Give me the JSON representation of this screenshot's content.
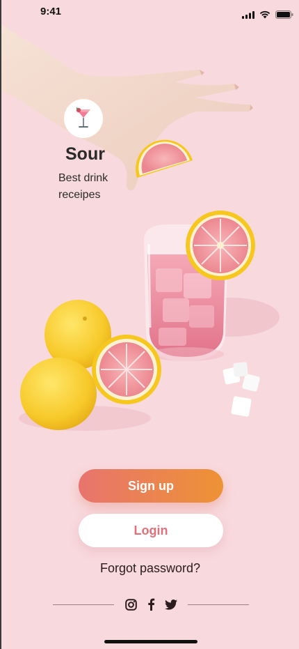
{
  "status_bar": {
    "time": "9:41",
    "icons": [
      "signal-icon",
      "wifi-icon",
      "battery-icon"
    ]
  },
  "brand": {
    "logo_icon": "cocktail-glass-icon",
    "name": "Sour",
    "tagline": "Best drink receipes"
  },
  "hero": {
    "illustration": "hand-holding-grapefruit-slice, pink drink glass with ice and grapefruit, lemons, halved grapefruit, sugar cubes"
  },
  "actions": {
    "signup_label": "Sign up",
    "login_label": "Login",
    "forgot_label": "Forgot password?"
  },
  "social": {
    "icons": [
      "instagram-icon",
      "facebook-icon",
      "twitter-icon"
    ]
  },
  "colors": {
    "background": "#f8d9dd",
    "signup_gradient_start": "#e8746d",
    "signup_gradient_end": "#ee9235",
    "login_text": "#e0707a"
  }
}
